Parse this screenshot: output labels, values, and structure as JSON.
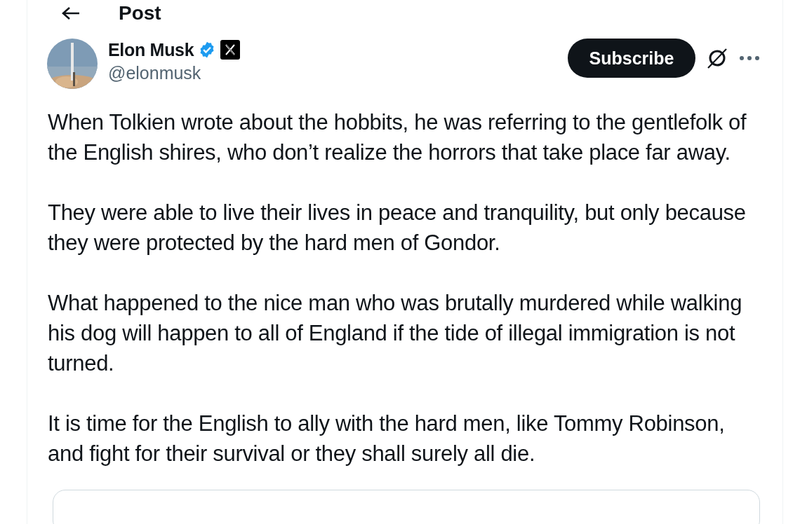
{
  "header": {
    "title": "Post"
  },
  "author": {
    "name": "Elon Musk",
    "verified": true,
    "handle": "@elonmusk"
  },
  "subscribe_button": "Subscribe",
  "paragraphs": [
    "When Tolkien wrote about the hobbits, he was referring to the gentlefolk of the English shires, who don’t realize the horrors that take place far away.",
    "They were able to live their lives in peace and tranquility, but only because they were protected by the hard men of Gondor.",
    "What happened to the nice man who was brutally murdered while walking his dog will happen to all of England if the tide of illegal immigration is not turned.",
    "It is time for the English to ally with the hard men, like Tommy Robinson, and fight for their survival or they shall surely all die."
  ]
}
